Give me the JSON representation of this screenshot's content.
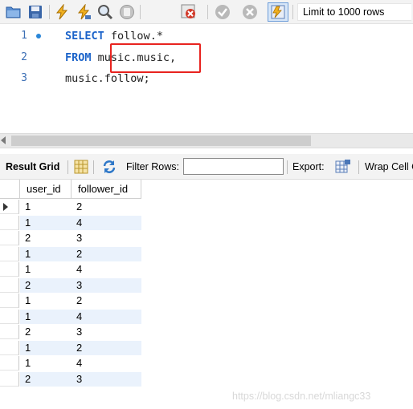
{
  "toolbar": {
    "buttons": [
      {
        "name": "open-folder-icon",
        "color": "#4a7fc4"
      },
      {
        "name": "save-icon",
        "color": "#3a66a8"
      },
      {
        "name": "execute-icon",
        "color": "#e8a317"
      },
      {
        "name": "execute-current-icon",
        "color": "#e8a317"
      },
      {
        "name": "explain-icon",
        "color": "#555555"
      },
      {
        "name": "stop-icon",
        "color": "#9a9a9a"
      },
      {
        "name": "toggle-error-icon",
        "color": "#d23a2a"
      },
      {
        "name": "commit-icon",
        "color": "#a5a5a5"
      },
      {
        "name": "rollback-icon",
        "color": "#a5a5a5"
      },
      {
        "name": "autocommit-icon",
        "color": "#e8a317"
      }
    ],
    "limit_label": "Limit to 1000 rows"
  },
  "editor": {
    "lines": [
      {
        "number": "1",
        "keyword": "SELECT",
        "rest": "follow.*",
        "has_marker": true
      },
      {
        "number": "2",
        "keyword": "FROM",
        "rest": "music.music,",
        "has_marker": false
      },
      {
        "number": "3",
        "keyword": "",
        "rest": "music.follow;",
        "has_marker": false
      }
    ],
    "highlight_color": "#e8231f"
  },
  "result_bar": {
    "result_grid_label": "Result Grid",
    "filter_label": "Filter Rows:",
    "filter_value": "",
    "export_label": "Export:",
    "wrap_label": "Wrap Cell C"
  },
  "grid": {
    "columns": [
      "user_id",
      "follower_id"
    ],
    "rows": [
      [
        "1",
        "2"
      ],
      [
        "1",
        "4"
      ],
      [
        "2",
        "3"
      ],
      [
        "1",
        "2"
      ],
      [
        "1",
        "4"
      ],
      [
        "2",
        "3"
      ],
      [
        "1",
        "2"
      ],
      [
        "1",
        "4"
      ],
      [
        "2",
        "3"
      ],
      [
        "1",
        "2"
      ],
      [
        "1",
        "4"
      ],
      [
        "2",
        "3"
      ]
    ],
    "selected_row": 0,
    "stripe_color": "#eaf2fc"
  },
  "watermark": "https://blog.csdn.net/mliangc33"
}
